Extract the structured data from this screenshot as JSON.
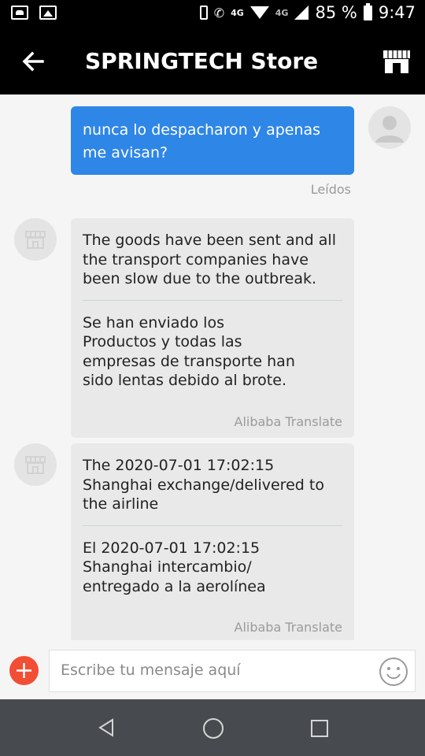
{
  "status_bar": {
    "network": "4G",
    "network2": "4G",
    "battery": "85 %",
    "time": "9:47"
  },
  "header": {
    "title": "SPRINGTECH Store",
    "back_icon": "arrow-left-icon",
    "store_icon": "store-icon"
  },
  "messages": [
    {
      "type": "outgoing",
      "text": "nunca lo despacharon y apenas me avisan?",
      "status": "Leídos"
    },
    {
      "type": "incoming",
      "original": "The goods have been sent and all the transport companies have been slow due to the outbreak.",
      "translated": "Se han enviado los Productos y todas las empresas de transporte han sido lentas debido al brote.",
      "translator": "Alibaba Translate"
    },
    {
      "type": "incoming",
      "original": "The 2020-07-01 17:02:15 Shanghai exchange/delivered to the airline",
      "translated": "El 2020-07-01 17:02:15 Shanghai intercambio/ entregado a la aerolínea",
      "translator": "Alibaba Translate"
    }
  ],
  "input": {
    "placeholder": "Escribe tu mensaje aquí"
  },
  "colors": {
    "outgoing_bubble": "#2e86e6",
    "incoming_bubble": "#e9e9e9",
    "add_button": "#f24e35",
    "header": "#000000",
    "navbar": "#474b50"
  }
}
